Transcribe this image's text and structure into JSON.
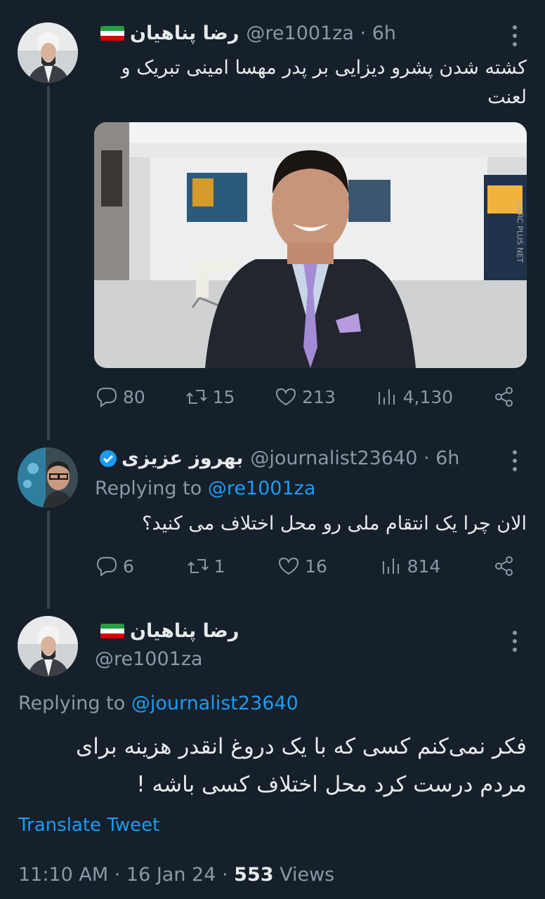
{
  "tweet1": {
    "display_name": "رضا پناهیان",
    "handle": "@re1001za",
    "time": "6h",
    "text": "کشته شدن پشرو دیزایی بر پدر مهسا امینی تبریک و لعنت",
    "stats": {
      "replies": "80",
      "retweets": "15",
      "likes": "213",
      "views": "4,130"
    },
    "image_watermark": "©ARC PLUS NET"
  },
  "tweet2": {
    "display_name": "بهروز عزیزی",
    "handle": "@journalist23640",
    "time": "6h",
    "replying_prefix": "Replying to",
    "replying_to": "@re1001za",
    "text": "الان چرا یک انتقام ملی رو محل اختلاف می کنید؟",
    "stats": {
      "replies": "6",
      "retweets": "1",
      "likes": "16",
      "views": "814"
    }
  },
  "main": {
    "display_name": "رضا پناهیان",
    "handle": "@re1001za",
    "replying_prefix": "Replying to",
    "replying_to": "@journalist23640",
    "text_line1": "فکر نمی‌کنم کسی که با یک دروغ انقدر هزینه برای",
    "text_line2": "مردم درست کرد محل اختلاف کسی باشه !",
    "translate": "Translate Tweet",
    "timestamp": "11:10 AM · 16 Jan 24 · ",
    "views_count": "553",
    "views_label": " Views"
  },
  "colors": {
    "background": "#15202b",
    "text": "#e7e9ea",
    "muted": "#8b98a5",
    "link": "#1d9bf0",
    "thread_line": "#38444d"
  },
  "icons": [
    "reply-icon",
    "retweet-icon",
    "like-icon",
    "views-icon",
    "share-icon",
    "more-icon",
    "verified-badge-icon",
    "iran-flag-icon"
  ]
}
